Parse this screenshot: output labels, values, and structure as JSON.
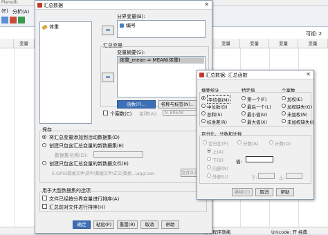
{
  "background": {
    "window_title": "Plansdb",
    "menu_items": [
      "(E)",
      "分析(A)"
    ],
    "visible_label": "可视: 2",
    "columns": [
      "变量",
      "变量",
      "变量",
      "变量",
      "变量",
      "变量",
      "变量",
      "变量"
    ],
    "status": "IBM SPSS Statistics 处理程序就绪",
    "status_right": "Unicode: 开  经典"
  },
  "main_dialog": {
    "title": "汇总数据",
    "source_list": [
      {
        "icon": "ruler-icon",
        "label": "体重"
      }
    ],
    "break_label": "分界变量(B):",
    "break_items": [
      {
        "icon": "nominal-icon",
        "label": "编号"
      }
    ],
    "aggregate_group": "汇总变量",
    "summaries_label": "变量摘要(S):",
    "summaries_items": [
      "体重_mean = MEAN(体重)"
    ],
    "function_button": "函数(F)...",
    "name_label_button": "名称与标签(N)...",
    "num_cases_label": "个案数(C)",
    "num_cases_name": "名称(A):",
    "num_cases_value": "N_BREAK",
    "save_group": "保存",
    "save_options": [
      "将汇总变量添加到活动数据集(D)",
      "创建只包含汇总变量的新数据集(E)",
      "创建只包含汇总变量的新数据文件(E)"
    ],
    "dataset_name_label": "数据集名称(D):",
    "file_button": "文件(L)...",
    "file_path": "E:\\SPSS数据文件\\资料\\数据文件\\正文\\数据...\\aggr.sav",
    "large_group": "用于大型数据集的选项",
    "large_options": [
      "文件已经按分界变量进行排序(A)",
      "汇总前对文件进行排序(H)"
    ],
    "buttons": [
      "确定",
      "粘贴(P)",
      "重置(R)",
      "取消",
      "帮助"
    ],
    "accent": "#3c6fb5"
  },
  "sub_dialog": {
    "title": "汇总数据: 汇总函数",
    "col_headers": [
      "摘要统计",
      "特定值",
      "个案数"
    ],
    "summary_stats": [
      "平均值(M)",
      "中位数(D)",
      "总和(S)",
      "标准差(R)"
    ],
    "specific_values": [
      "第一个(F)",
      "最后一个(L)",
      "最小值(U)",
      "最大值(X)"
    ],
    "case_counts": [
      "加权(E)",
      "加权缺失(G)",
      "未加权(N)",
      "未加权缺失(I)"
    ],
    "selected": "平均值(M)",
    "percent_group": "百分比、分数和计数",
    "percent_types": [
      "百分比(P)",
      "分数(A)",
      "计数(O)"
    ],
    "direction_options": [
      "上(A)",
      "下(B)",
      "内部(N)",
      "外部(U)"
    ],
    "value_label": "值:",
    "low_label": "下:",
    "high_label": "上:",
    "buttons": [
      "继续(C)",
      "取消",
      "帮助"
    ]
  }
}
